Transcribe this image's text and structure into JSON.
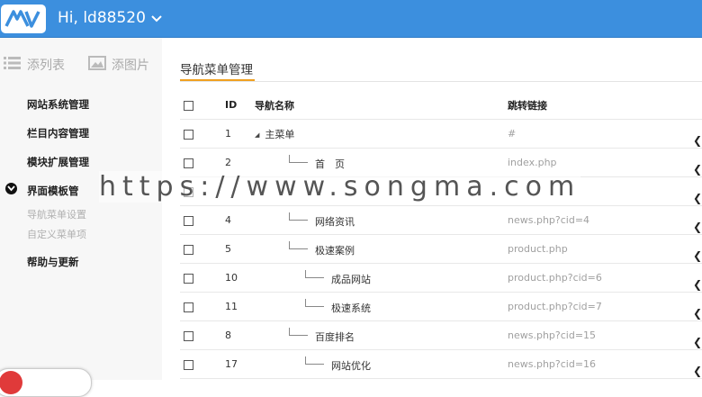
{
  "header": {
    "greeting": "Hi, ld88520",
    "brand_color": "#3c8fde"
  },
  "sidebar": {
    "quick_add_list": "添列表",
    "quick_add_image": "添图片",
    "menu": [
      {
        "label": "网站系统管理"
      },
      {
        "label": "栏目内容管理"
      },
      {
        "label": "模块扩展管理"
      },
      {
        "label": "界面模板管"
      },
      {
        "label": "帮助与更新"
      }
    ],
    "submenu": [
      {
        "label": "导航菜单设置"
      },
      {
        "label": "自定义菜单项"
      }
    ]
  },
  "main": {
    "title": "导航菜单管理",
    "accent_color": "#f0a020",
    "columns": {
      "id": "ID",
      "name": "导航名称",
      "link": "跳转链接"
    },
    "rows": [
      {
        "id": "1",
        "name": "主菜单",
        "link": "#"
      },
      {
        "id": "2",
        "name": "首　页",
        "link": "index.php"
      },
      {
        "id": "",
        "name": "",
        "link": ""
      },
      {
        "id": "4",
        "name": "网络资讯",
        "link": "news.php?cid=4"
      },
      {
        "id": "5",
        "name": "极速案例",
        "link": "product.php"
      },
      {
        "id": "10",
        "name": "成品网站",
        "link": "product.php?cid=6"
      },
      {
        "id": "11",
        "name": "极速系统",
        "link": "product.php?cid=7"
      },
      {
        "id": "8",
        "name": "百度排名",
        "link": "news.php?cid=15"
      },
      {
        "id": "17",
        "name": "网站优化",
        "link": "news.php?cid=16"
      }
    ]
  },
  "watermark": "https://www.songma.com"
}
